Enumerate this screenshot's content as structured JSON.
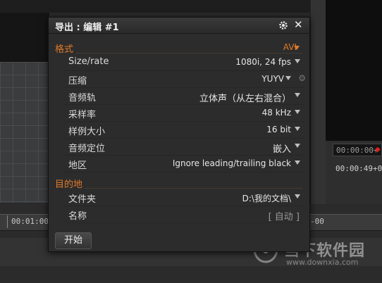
{
  "dialog": {
    "title": "导出 : 编辑 #1",
    "format_section": "格式",
    "format_value": "AVI",
    "rows": [
      {
        "label": "Size/rate",
        "value": "1080i, 24 fps"
      },
      {
        "label": "压缩",
        "value": "YUYV"
      },
      {
        "label": "音频轨",
        "value": "立体声（从左右混合）"
      },
      {
        "label": "采样率",
        "value": "48 kHz"
      },
      {
        "label": "样例大小",
        "value": "16 bit"
      },
      {
        "label": "音频定位",
        "value": "嵌入"
      },
      {
        "label": "地区",
        "value": "Ignore leading/trailing black"
      }
    ],
    "dest_section": "目的地",
    "dest_rows": [
      {
        "label": "文件夹",
        "value": "D:\\我的文档\\"
      },
      {
        "label": "名称",
        "value": "[ 自动 ]"
      }
    ],
    "start_button": "开始"
  },
  "background": {
    "timecode_box": "00:00:00+",
    "timecode_display": "00:00:49+0",
    "ruler_left": "00:01:00",
    "ruler_right": "-00"
  },
  "watermark": {
    "name": "当下软件园",
    "url": "www.downxia.com"
  },
  "colors": {
    "accent": "#e07a2a",
    "dialog_bg": "#2c2c2c"
  }
}
